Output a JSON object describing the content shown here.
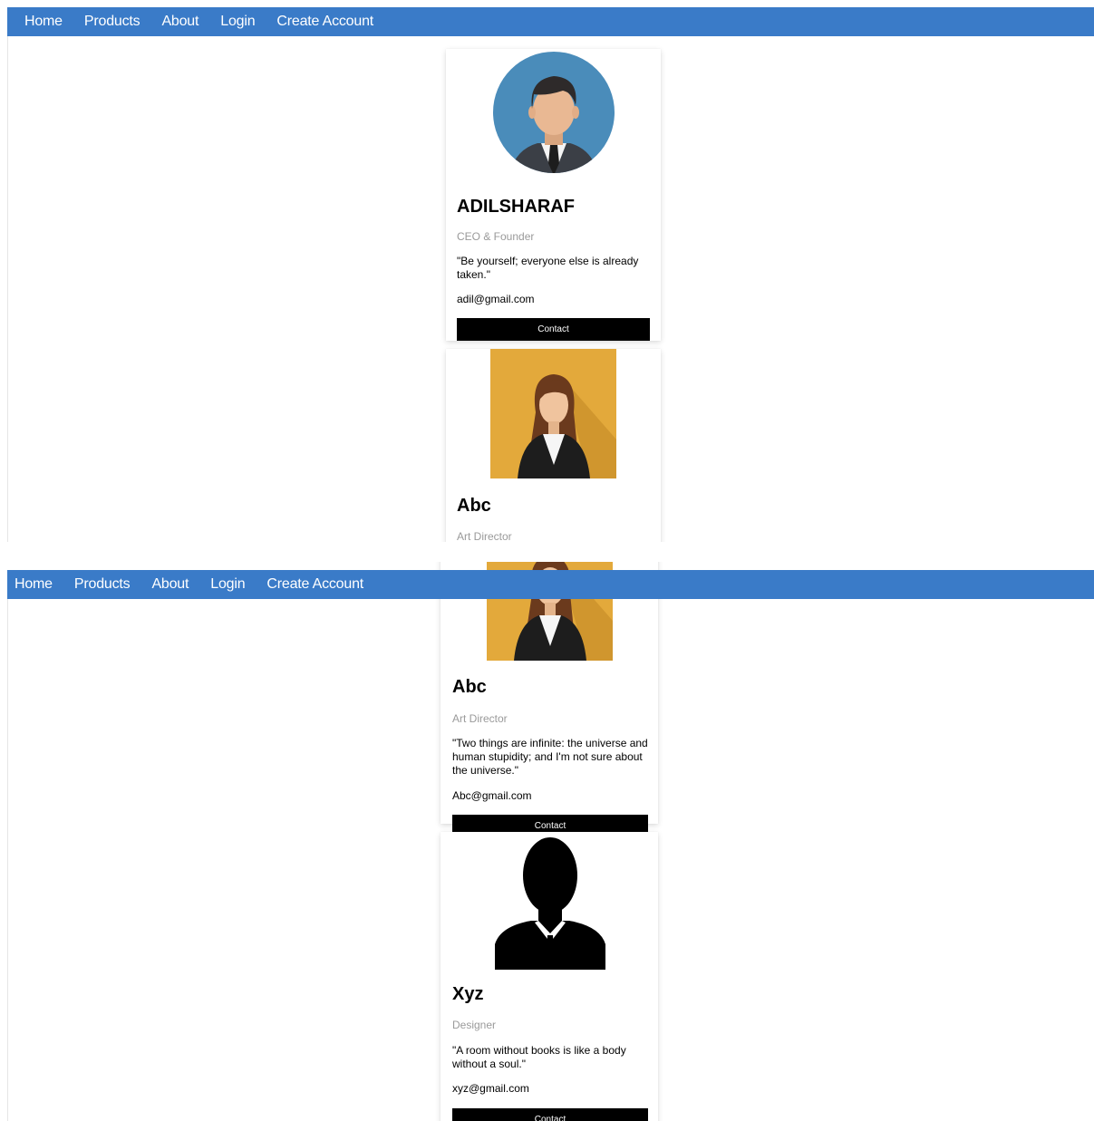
{
  "nav": {
    "items": [
      "Home",
      "Products",
      "About",
      "Login",
      "Create Account"
    ]
  },
  "team": [
    {
      "name": "ADILSHARAF",
      "title": "CEO & Founder",
      "quote": "\"Be yourself; everyone else is already taken.\"",
      "email": "adil@gmail.com",
      "contact_label": "Contact",
      "avatar": "man-in-suit-avatar"
    },
    {
      "name": "Abc",
      "title": "Art Director",
      "quote": "\"Two things are infinite: the universe and human stupidity; and I'm not sure about the universe.\"",
      "email": "Abc@gmail.com",
      "contact_label": "Contact",
      "avatar": "woman-avatar"
    },
    {
      "name": "Xyz",
      "title": "Designer",
      "quote": "\"A room without books is like a body without a soul.\"",
      "email": "xyz@gmail.com",
      "contact_label": "Contact",
      "avatar": "silhouette-avatar"
    }
  ],
  "colors": {
    "navbar": "#3a7bc8",
    "avatar_circle": "#4a8cba",
    "woman_background": "#e3a93b",
    "contact_button": "#000000",
    "job_title_text": "#9a9a9a"
  }
}
